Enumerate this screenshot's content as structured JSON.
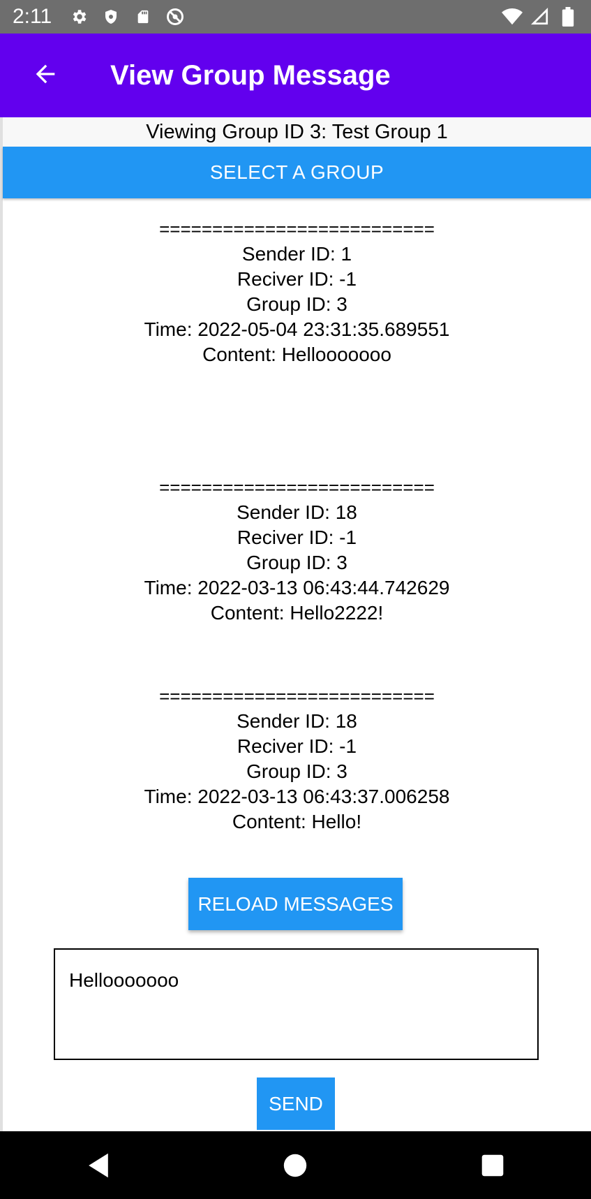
{
  "status_bar": {
    "time": "2:11",
    "left_icons": [
      "gear-icon",
      "shield-icon",
      "sd-card-icon",
      "no-sync-icon"
    ],
    "right_icons": [
      "wifi-icon",
      "signal-icon",
      "battery-icon"
    ]
  },
  "app_bar": {
    "title": "View Group Message",
    "back_icon": "arrow-back-icon",
    "color": "#6200ee"
  },
  "group_heading": "Viewing Group ID 3: Test Group 1",
  "select_group_label": "SELECT A GROUP",
  "messages": [
    {
      "separator": "==========================",
      "sender": "Sender ID: 1",
      "receiver": "Reciver ID: -1",
      "group": "Group ID: 3",
      "time": "Time: 2022-05-04 23:31:35.689551",
      "content": "Content: Hellooooooo"
    },
    {
      "separator": "==========================",
      "sender": "Sender ID: 18",
      "receiver": "Reciver ID: -1",
      "group": "Group ID: 3",
      "time": "Time: 2022-03-13 06:43:44.742629",
      "content": "Content: Hello2222!"
    },
    {
      "separator": "==========================",
      "sender": "Sender ID: 18",
      "receiver": "Reciver ID: -1",
      "group": "Group ID: 3",
      "time": "Time: 2022-03-13 06:43:37.006258",
      "content": "Content: Hello!"
    }
  ],
  "reload_label": "RELOAD MESSAGES",
  "message_input_value": "Hellooooooo",
  "send_label": "SEND",
  "accent_color": "#2196f3",
  "nav_bar": {
    "icons": [
      "back-triangle-icon",
      "home-circle-icon",
      "recents-square-icon"
    ]
  }
}
